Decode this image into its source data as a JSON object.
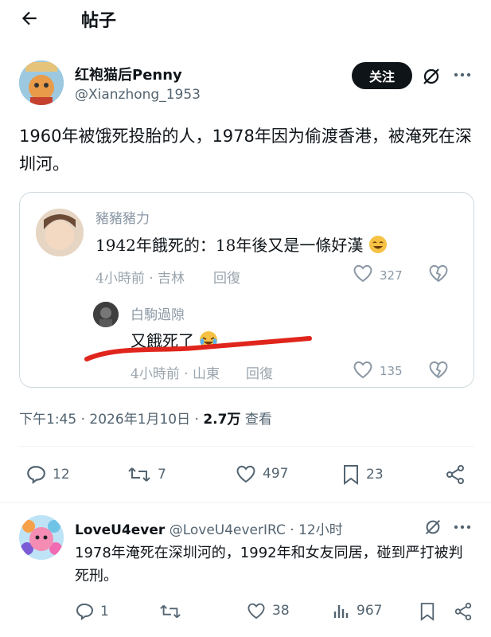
{
  "header": {
    "back_icon": "arrow-left-icon",
    "title": "帖子"
  },
  "post": {
    "author_name": "红袍猫后Penny",
    "author_handle": "@Xianzhong_1953",
    "follow_label": "关注",
    "text": "1960年被饿死投胎的人，1978年因为偷渡香港，被淹死在深圳河。",
    "timestamp": "下午1:45 · 2026年1月10日 · ",
    "views_count": "2.7万",
    "views_label": " 查看",
    "actions": {
      "replies": "12",
      "reposts": "7",
      "likes": "497",
      "bookmarks": "23"
    }
  },
  "quote": {
    "comment1": {
      "user": "豬豬豬力",
      "text": "1942年餓死的：18年後又是一條好漢",
      "meta": "4小時前 · 吉林",
      "reply": "回復",
      "likes": "327"
    },
    "comment2": {
      "user": "白駒過隙",
      "text": "又餓死了",
      "meta": "4小時前 · 山東",
      "reply": "回復",
      "likes": "135"
    }
  },
  "reply": {
    "author_name": "LoveU4ever",
    "author_handle": "@LoveU4everIRC",
    "time": " · 12小时",
    "text": "1978年淹死在深圳河的，1992年和女友同居，碰到严打被判死刑。",
    "actions": {
      "replies": "1",
      "reposts": "",
      "likes": "38",
      "views": "967"
    }
  },
  "colors": {
    "accent": "#0f1419",
    "muted": "#536471",
    "border": "#cfd9de",
    "red_underline": "#e0251c"
  }
}
